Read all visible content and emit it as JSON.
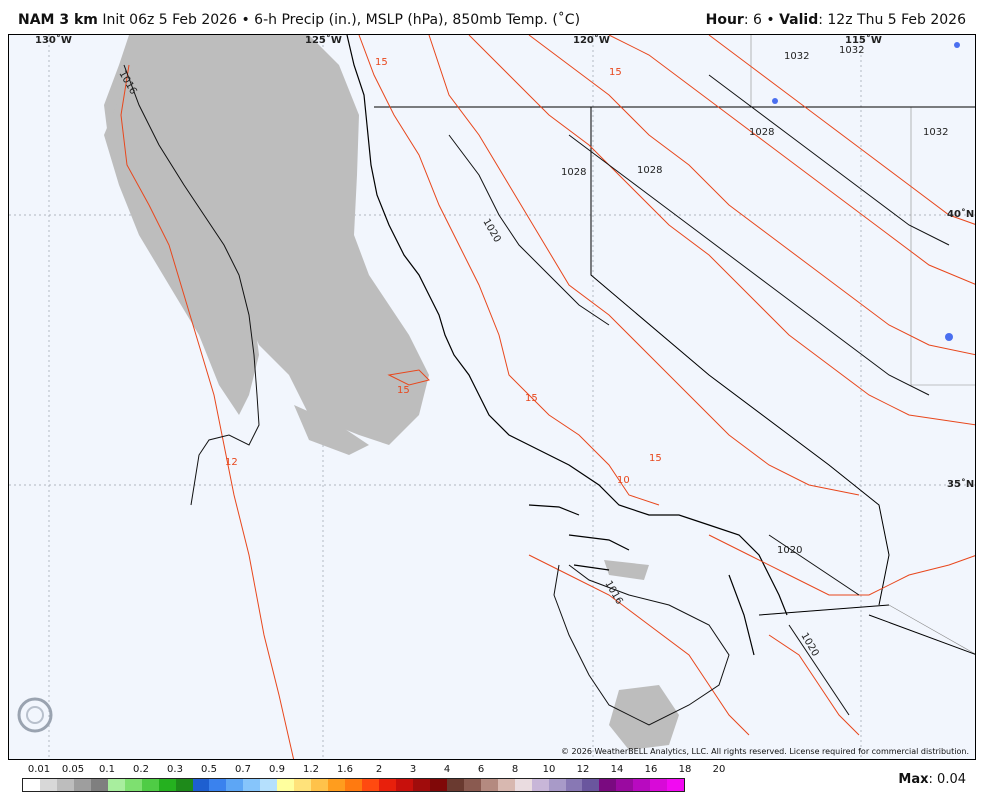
{
  "header": {
    "model": "NAM 3 km",
    "init": "Init 06z 5 Feb 2026",
    "sep": "•",
    "fields": "6-h Precip (in.), MSLP (hPa), 850mb Temp. (˚C)",
    "hour_label": "Hour",
    "hour_value": ": 6",
    "valid_label": "Valid",
    "valid_value": ": 12z Thu 5 Feb 2026"
  },
  "map": {
    "lon_labels": [
      "130˚W",
      "125˚W",
      "120˚W",
      "115˚W"
    ],
    "lat_labels": [
      "40˚N",
      "35˚N"
    ],
    "isobar_labels": [
      "1016",
      "1020",
      "1028",
      "1028",
      "1028",
      "1032",
      "1032",
      "1032",
      "1016",
      "1020",
      "1020"
    ],
    "isotherm_labels": [
      "15",
      "15",
      "15",
      "15",
      "12",
      "10",
      "15"
    ],
    "copyright": "© 2026 WeatherBELL Analytics, LLC. All rights reserved. License required for commercial distribution.",
    "logo_text": "WEATHERBELL",
    "colors": {
      "ocean_land": "#f2f6fd",
      "precip": "#bdbdbd",
      "coast": "#000000",
      "border": "#8a8a8a",
      "isotherm": "#e8471c",
      "isobar": "#111111"
    }
  },
  "legend": {
    "ticks": [
      "0.01",
      "0.05",
      "0.1",
      "0.2",
      "0.3",
      "0.5",
      "0.7",
      "0.9",
      "1.2",
      "1.6",
      "2",
      "3",
      "4",
      "6",
      "8",
      "10",
      "12",
      "14",
      "16",
      "18",
      "20"
    ],
    "colors": [
      "#ffffff",
      "#d8d8d8",
      "#bdbdbd",
      "#9e9e9e",
      "#7f7f7f",
      "#a8ee9e",
      "#7ee070",
      "#4fcc45",
      "#25b11f",
      "#1e8a1a",
      "#1e5fd0",
      "#3a82ee",
      "#5da6f5",
      "#86c5fb",
      "#b5e0fd",
      "#ffff9e",
      "#ffe27a",
      "#ffc24a",
      "#ff9d1e",
      "#ff7a10",
      "#ff4a10",
      "#e8200c",
      "#c8100c",
      "#a00c0c",
      "#800808",
      "#6a3a30",
      "#8a5a50",
      "#b48a80",
      "#d8b8b0",
      "#eadce0",
      "#c8b6d8",
      "#a89ac8",
      "#8878b4",
      "#6a569e",
      "#7a0a80",
      "#9a0aa0",
      "#b80ac0",
      "#d80ad8",
      "#f20af2"
    ],
    "max_label": "Max",
    "max_value": ": 0.04"
  }
}
